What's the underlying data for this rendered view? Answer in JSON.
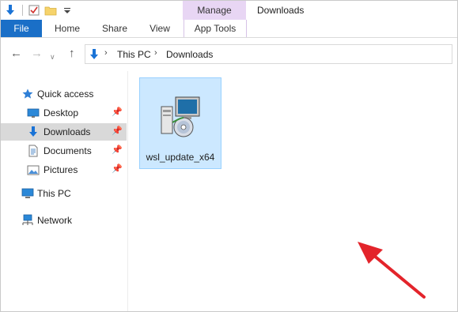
{
  "window": {
    "title": "Downloads"
  },
  "ribbon": {
    "contextual_group": "Manage",
    "tabs": [
      "File",
      "Home",
      "Share",
      "View",
      "App Tools"
    ]
  },
  "address": {
    "segments": [
      "This PC",
      "Downloads"
    ]
  },
  "sidebar": {
    "quick_access_label": "Quick access",
    "items": [
      {
        "label": "Desktop",
        "icon": "desktop-icon",
        "pinned": true
      },
      {
        "label": "Downloads",
        "icon": "downloads-icon",
        "pinned": true,
        "selected": true
      },
      {
        "label": "Documents",
        "icon": "documents-icon",
        "pinned": true
      },
      {
        "label": "Pictures",
        "icon": "pictures-icon",
        "pinned": true
      }
    ],
    "this_pc_label": "This PC",
    "network_label": "Network"
  },
  "files": [
    {
      "name": "wsl_update_x64",
      "icon": "installer-icon",
      "selected": true
    }
  ],
  "colors": {
    "accent": "#1a6fc7",
    "manage_group": "#e8d6f4",
    "selection": "#cce8ff",
    "selection_border": "#99d1ff",
    "annotation_arrow": "#e3242b"
  }
}
